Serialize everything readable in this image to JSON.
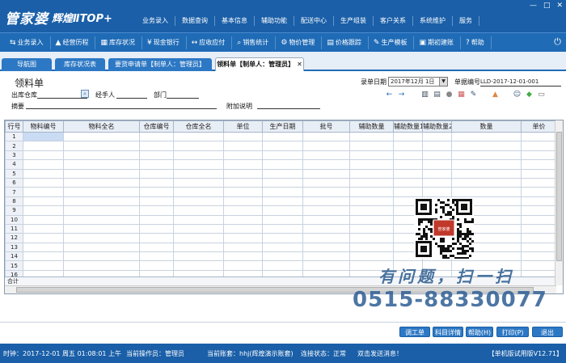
{
  "app": {
    "brand": "管家婆",
    "edition": "辉煌ⅡTOP+"
  },
  "menu": [
    "业务录入",
    "数据查询",
    "基本信息",
    "辅助功能",
    "配送中心",
    "生产组装",
    "客户关系",
    "系统维护",
    "服务"
  ],
  "window_controls": {
    "minimize": "—",
    "maximize": "□",
    "close": "✕"
  },
  "toolbar": [
    {
      "icon": "document-icon",
      "glyph": "⇆",
      "label": "业务录入"
    },
    {
      "icon": "chart-icon",
      "glyph": "▲",
      "label": "经营历程"
    },
    {
      "icon": "box-icon",
      "glyph": "▦",
      "label": "库存状况"
    },
    {
      "icon": "yen-icon",
      "glyph": "¥",
      "label": "现金银行"
    },
    {
      "icon": "exchange-icon",
      "glyph": "↔",
      "label": "应收应付"
    },
    {
      "icon": "search-icon",
      "glyph": "⌕",
      "label": "销售统计"
    },
    {
      "icon": "gear-icon",
      "glyph": "⚙",
      "label": "物价管理"
    },
    {
      "icon": "price-icon",
      "glyph": "▤",
      "label": "价格跟踪"
    },
    {
      "icon": "wrench-icon",
      "glyph": "✎",
      "label": "生产模板"
    },
    {
      "icon": "calendar-icon",
      "glyph": "▣",
      "label": "期初建账"
    },
    {
      "icon": "help-icon",
      "glyph": "?",
      "label": "帮助"
    }
  ],
  "power_icon": "⏻",
  "tabs": [
    {
      "label": "导航图",
      "active": false
    },
    {
      "label": "库存状况表",
      "active": false
    },
    {
      "label": "要货申请单【制单人：管理员】",
      "active": false
    },
    {
      "label": "领料单【制单人：管理员】",
      "active": true
    }
  ],
  "form": {
    "title": "领料单",
    "out_warehouse_label": "出库仓库",
    "handler_label": "经手人",
    "dept_label": "部门",
    "summary_label": "摘要",
    "extra_label": "附加说明",
    "date_label": "录单日期",
    "date_value": "2017年12月 1日",
    "billno_label": "单据编号",
    "billno_value": "LLD-2017-12-01-001"
  },
  "tool_icons": [
    "←",
    "→",
    "▥",
    "▤",
    "●",
    "▦",
    "✎",
    "▲",
    "☺",
    "◆",
    "▭"
  ],
  "grid": {
    "columns": [
      "行号",
      "物料编号",
      "物料全名",
      "仓库编号",
      "仓库全名",
      "单位",
      "生产日期",
      "批号",
      "辅助数量",
      "辅助数量1",
      "辅助数量2",
      "数量",
      "单价"
    ],
    "rows": [
      "1",
      "2",
      "3",
      "4",
      "5",
      "6",
      "7",
      "8",
      "9",
      "10",
      "11",
      "12",
      "13",
      "14",
      "15",
      "16"
    ],
    "sum_label": "合计"
  },
  "promo": {
    "tagline": "有问题，扫一扫",
    "phone": "0515-88330077",
    "qr_badge": "管家婆"
  },
  "buttons": [
    "调工单",
    "科目详情",
    "帮助(H)",
    "打印(P)",
    "退出"
  ],
  "status": {
    "time": "时钟：2017-12-01 周五 01:08:01 上午",
    "operator": "当前操作员：管理员",
    "account": "当前账套：hhj(辉煌演示账套)",
    "conn": "连接状态：正常",
    "msg": "双击发送消息！",
    "version": "【单机版试用版V12.71】"
  }
}
